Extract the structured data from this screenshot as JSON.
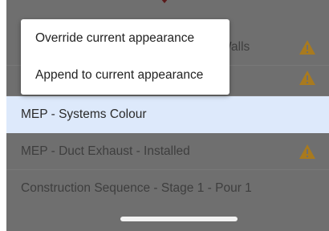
{
  "popup_menu": {
    "items": [
      {
        "label": "Override current appearance"
      },
      {
        "label": "Append to current appearance"
      }
    ]
  },
  "appearance_list": {
    "items": [
      {
        "label": "Walls",
        "warning": true
      },
      {
        "label": "",
        "warning": true
      },
      {
        "label": "MEP - Systems Colour",
        "selected": true,
        "warning": false
      },
      {
        "label": "MEP - Duct Exhaust - Installed",
        "warning": true
      },
      {
        "label": "Construction Sequence - Stage 1 - Pour 1",
        "warning": false
      }
    ]
  },
  "icons": {
    "warning": "warning-triangle-icon",
    "top": "chevron-down-icon"
  },
  "colors": {
    "overlay": "#6f6f6f",
    "selected_row": "#dde9fb",
    "warning_icon": "#a87a1f"
  }
}
